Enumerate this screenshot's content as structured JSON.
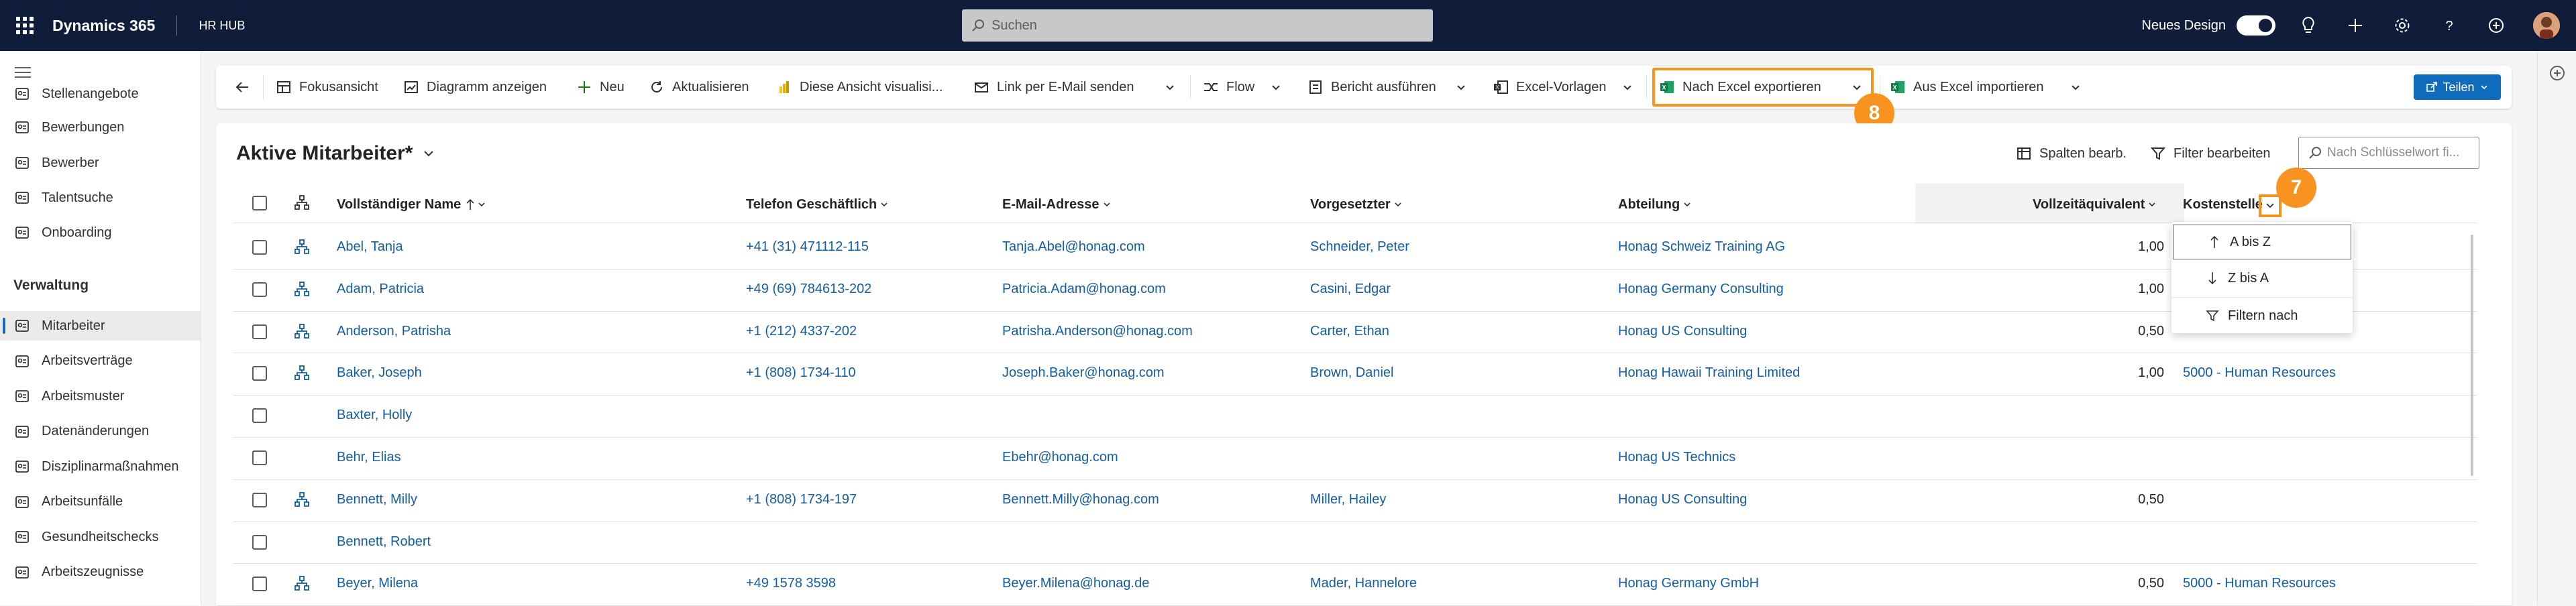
{
  "topbar": {
    "app_name": "Dynamics 365",
    "environment": "HR HUB",
    "search_placeholder": "Suchen",
    "new_design_label": "Neues Design",
    "new_design_on": true
  },
  "nav": {
    "items_top": [
      {
        "label": "Stellenangebote",
        "icon": "briefcase-icon"
      },
      {
        "label": "Bewerbungen",
        "icon": "document-icon"
      },
      {
        "label": "Bewerber",
        "icon": "contact-card-icon"
      },
      {
        "label": "Talentsuche",
        "icon": "person-search-icon"
      },
      {
        "label": "Onboarding",
        "icon": "person-add-icon"
      }
    ],
    "group_label": "Verwaltung",
    "items_group": [
      {
        "label": "Mitarbeiter",
        "icon": "contact-card-icon",
        "active": true
      },
      {
        "label": "Arbeitsverträge",
        "icon": "document-icon"
      },
      {
        "label": "Arbeitsmuster",
        "icon": "calendar-icon"
      },
      {
        "label": "Datenänderungen",
        "icon": "edit-document-icon"
      },
      {
        "label": "Disziplinarmaßnahmen",
        "icon": "warning-document-icon"
      },
      {
        "label": "Arbeitsunfälle",
        "icon": "person-warning-icon"
      },
      {
        "label": "Gesundheitschecks",
        "icon": "health-icon"
      },
      {
        "label": "Arbeitszeugnisse",
        "icon": "certificate-icon"
      }
    ]
  },
  "commandbar": {
    "back": "Zurück",
    "focus_view": "Fokusansicht",
    "show_chart": "Diagramm anzeigen",
    "new": "Neu",
    "refresh": "Aktualisieren",
    "visualize": "Diese Ansicht visualisi...",
    "email_link": "Link per E-Mail senden",
    "flow": "Flow",
    "run_report": "Bericht ausführen",
    "excel_templates": "Excel-Vorlagen",
    "export_excel": "Nach Excel exportieren",
    "import_excel": "Aus Excel importieren",
    "share": "Teilen"
  },
  "callouts": {
    "badge_export": "8",
    "badge_column": "7"
  },
  "view": {
    "title": "Aktive Mitarbeiter*",
    "edit_columns": "Spalten bearb.",
    "edit_filters": "Filter bearbeiten",
    "keyword_placeholder": "Nach Schlüsselwort fi..."
  },
  "columns": {
    "name": "Vollständiger Name",
    "phone": "Telefon Geschäftlich",
    "email": "E-Mail-Adresse",
    "manager": "Vorgesetzter",
    "department": "Abteilung",
    "fte": "Vollzeitäquivalent",
    "cost_center": "Kostenstelle"
  },
  "rows": [
    {
      "name": "Abel, Tanja",
      "phone": "+41 (31) 471112-115",
      "email": "Tanja.Abel@honag.com",
      "manager": "Schneider, Peter",
      "department": "Honag Schweiz Training AG",
      "fte": "1,00",
      "cost_center": "",
      "hierarchy": true
    },
    {
      "name": "Adam, Patricia",
      "phone": "+49 (69) 784613-202",
      "email": "Patricia.Adam@honag.com",
      "manager": "Casini, Edgar",
      "department": "Honag Germany Consulting",
      "fte": "1,00",
      "cost_center": "",
      "hierarchy": true
    },
    {
      "name": "Anderson, Patrisha",
      "phone": "+1 (212) 4337-202",
      "email": "Patrisha.Anderson@honag.com",
      "manager": "Carter, Ethan",
      "department": "Honag US Consulting",
      "fte": "0,50",
      "cost_center": "",
      "hierarchy": true
    },
    {
      "name": "Baker, Joseph",
      "phone": "+1 (808) 1734-110",
      "email": "Joseph.Baker@honag.com",
      "manager": "Brown, Daniel",
      "department": "Honag Hawaii Training Limited",
      "fte": "1,00",
      "cost_center": "5000 - Human Resources",
      "hierarchy": true
    },
    {
      "name": "Baxter, Holly",
      "phone": "",
      "email": "",
      "manager": "",
      "department": "",
      "fte": "",
      "cost_center": "",
      "hierarchy": false
    },
    {
      "name": "Behr, Elias",
      "phone": "",
      "email": "Ebehr@honag.com",
      "manager": "",
      "department": "Honag US Technics",
      "fte": "",
      "cost_center": "",
      "hierarchy": false
    },
    {
      "name": "Bennett, Milly",
      "phone": "+1 (808) 1734-197",
      "email": "Bennett.Milly@honag.com",
      "manager": "Miller, Hailey",
      "department": "Honag US Consulting",
      "fte": "0,50",
      "cost_center": "",
      "hierarchy": true
    },
    {
      "name": "Bennett, Robert",
      "phone": "",
      "email": "",
      "manager": "",
      "department": "",
      "fte": "",
      "cost_center": "",
      "hierarchy": false
    },
    {
      "name": "Beyer, Milena",
      "phone": "+49 1578 3598",
      "email": "Beyer.Milena@honag.de",
      "manager": "Mader, Hannelore",
      "department": "Honag Germany GmbH",
      "fte": "0,50",
      "cost_center": "5000 - Human Resources",
      "hierarchy": true
    }
  ],
  "column_menu": {
    "sort_asc": "A bis Z",
    "sort_desc": "Z bis A",
    "filter_by": "Filtern nach"
  },
  "colors": {
    "topbar": "#0f1d3a",
    "accent": "#0f6cbd",
    "link": "#115ea3",
    "callout": "#f7931e"
  }
}
